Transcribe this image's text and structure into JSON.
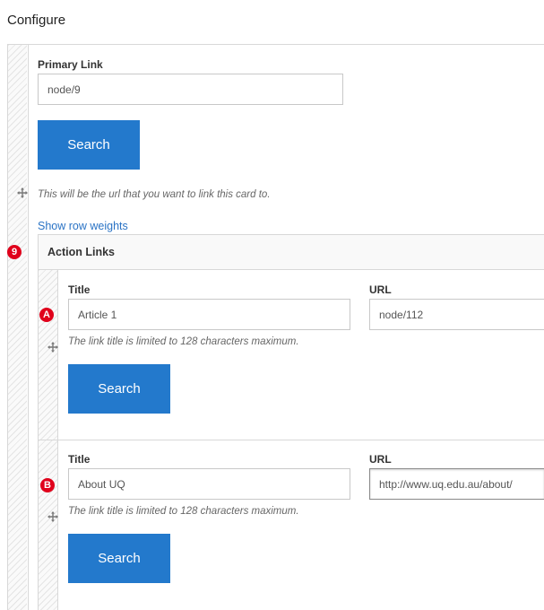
{
  "page": {
    "title": "Configure"
  },
  "primary_link": {
    "label": "Primary Link",
    "value": "node/9",
    "search_label": "Search",
    "help": "This will be the url that you want to link this card to."
  },
  "show_row_weights": "Show row weights",
  "action_links": {
    "heading": "Action Links",
    "badge": "9",
    "rows": [
      {
        "badge": "A",
        "title_label": "Title",
        "title_value": "Article 1",
        "url_label": "URL",
        "url_value": "node/112",
        "help": "The link title is limited to 128 characters maximum.",
        "search_label": "Search"
      },
      {
        "badge": "B",
        "title_label": "Title",
        "title_value": "About UQ",
        "url_label": "URL",
        "url_value": "http://www.uq.edu.au/about/",
        "help": "The link title is limited to 128 characters maximum.",
        "search_label": "Search"
      }
    ]
  },
  "colors": {
    "primary_button": "#2379cc",
    "badge": "#e0001b",
    "link": "#2a73c5"
  }
}
